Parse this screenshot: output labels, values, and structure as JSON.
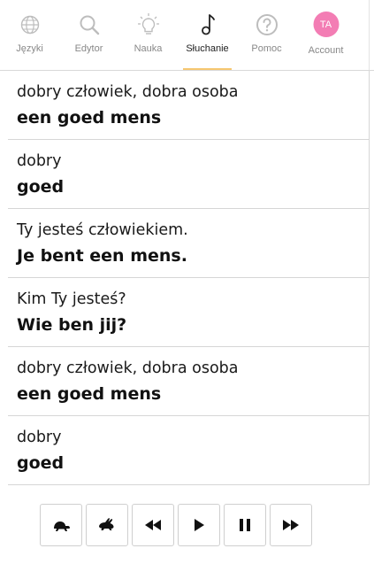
{
  "nav": {
    "items": [
      {
        "label": "Języki",
        "icon": "globe-icon"
      },
      {
        "label": "Edytor",
        "icon": "search-icon"
      },
      {
        "label": "Nauka",
        "icon": "lightbulb-icon"
      },
      {
        "label": "Słuchanie",
        "icon": "music-note-icon",
        "active": true
      },
      {
        "label": "Pomoc",
        "icon": "help-icon"
      },
      {
        "label": "Account",
        "icon": "avatar",
        "initials": "TA"
      }
    ],
    "accent_color": "#f6c770",
    "avatar_color": "#f37db4"
  },
  "phrases": [
    {
      "source": "dobry człowiek, dobra osoba",
      "target": "een goed mens"
    },
    {
      "source": "dobry",
      "target": "goed"
    },
    {
      "source": "Ty jesteś człowiekiem.",
      "target": "Je bent een mens."
    },
    {
      "source": "Kim Ty jesteś?",
      "target": "Wie ben jij?"
    },
    {
      "source": "dobry człowiek, dobra osoba",
      "target": "een goed mens"
    },
    {
      "source": "dobry",
      "target": "goed"
    }
  ],
  "player": {
    "buttons": [
      {
        "name": "slow-turtle-button",
        "icon": "turtle-icon"
      },
      {
        "name": "fast-rabbit-button",
        "icon": "rabbit-icon"
      },
      {
        "name": "rewind-button",
        "icon": "rewind-icon"
      },
      {
        "name": "play-button",
        "icon": "play-icon"
      },
      {
        "name": "pause-button",
        "icon": "pause-icon"
      },
      {
        "name": "fast-forward-button",
        "icon": "fast-forward-icon"
      }
    ]
  }
}
